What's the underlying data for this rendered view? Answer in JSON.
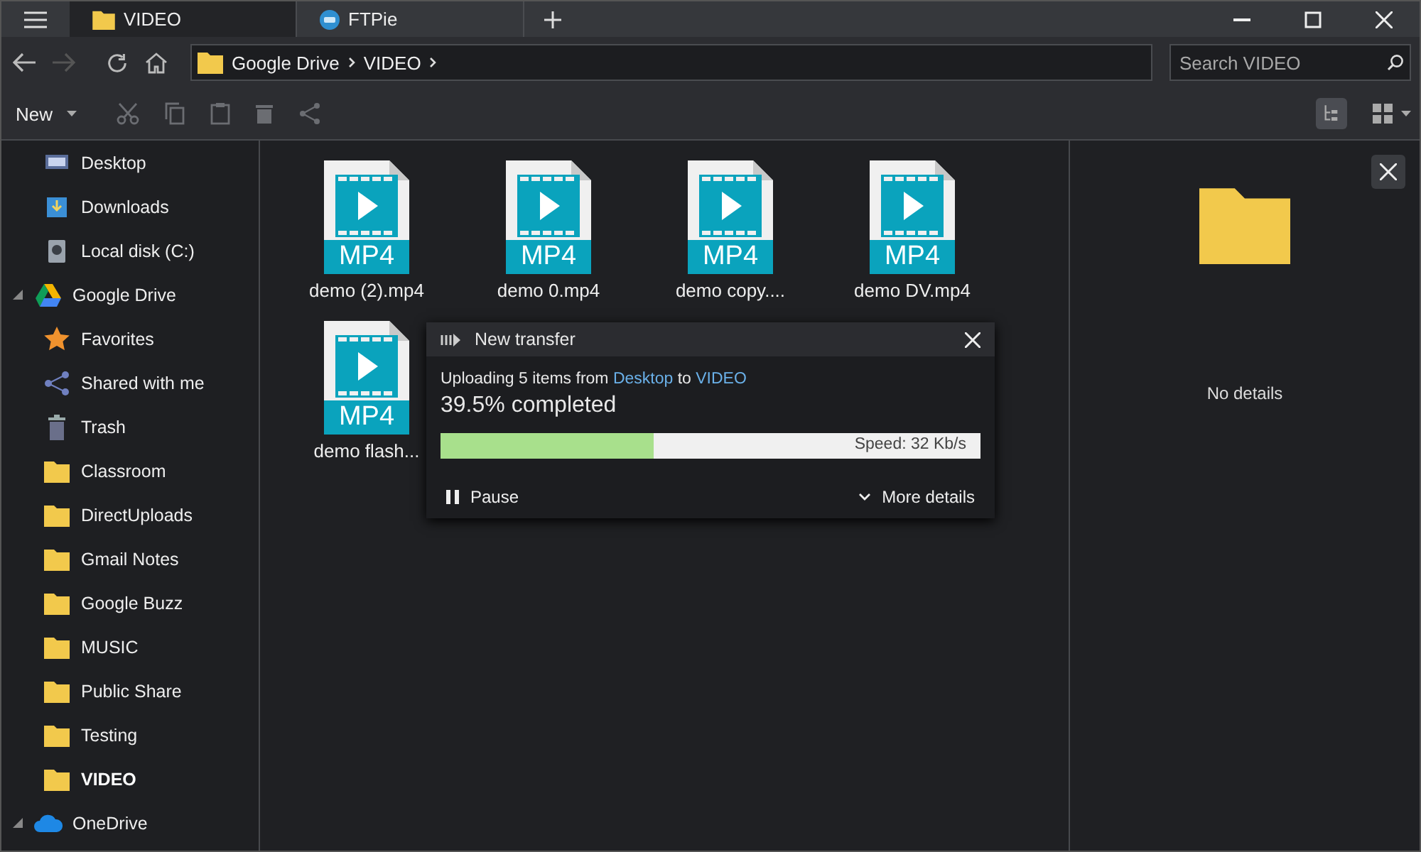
{
  "tabs": [
    {
      "label": "VIDEO",
      "kind": "folder",
      "selected": true
    },
    {
      "label": "FTPie",
      "kind": "app",
      "selected": false
    }
  ],
  "address": {
    "crumbs": [
      "Google Drive",
      "VIDEO"
    ]
  },
  "search": {
    "placeholder": "Search VIDEO"
  },
  "toolbar": {
    "new_label": "New"
  },
  "sidebar": {
    "items": [
      {
        "children": [
          {
            "label": "Desktop",
            "kind": "desktop",
            "selected": false
          },
          {
            "label": "Downloads",
            "kind": "download",
            "selected": false
          },
          {
            "label": "Local disk (C:)",
            "kind": "disk",
            "selected": false
          }
        ]
      },
      {
        "label": "Google Drive",
        "kind": "gdrive",
        "selected": false,
        "expanded": true,
        "children": [
          {
            "label": "Favorites",
            "kind": "star",
            "selected": false
          },
          {
            "label": "Shared with me",
            "kind": "share",
            "selected": false
          },
          {
            "label": "Trash",
            "kind": "trash",
            "selected": false
          },
          {
            "label": "Classroom",
            "kind": "folder",
            "selected": false
          },
          {
            "label": "DirectUploads",
            "kind": "folder",
            "selected": false
          },
          {
            "label": "Gmail Notes",
            "kind": "folder",
            "selected": false
          },
          {
            "label": "Google Buzz",
            "kind": "folder",
            "selected": false
          },
          {
            "label": "MUSIC",
            "kind": "folder",
            "selected": false
          },
          {
            "label": "Public Share",
            "kind": "folder",
            "selected": false
          },
          {
            "label": "Testing",
            "kind": "folder",
            "selected": false
          },
          {
            "label": "VIDEO",
            "kind": "folder",
            "selected": true
          }
        ]
      },
      {
        "label": "OneDrive",
        "kind": "cloud",
        "selected": false,
        "expanded": true
      }
    ]
  },
  "files": [
    {
      "badge": "MP4",
      "name": "demo (2).mp4"
    },
    {
      "badge": "MP4",
      "name": "demo 0.mp4"
    },
    {
      "badge": "MP4",
      "name": "demo copy...."
    },
    {
      "badge": "MP4",
      "name": "demo DV.mp4"
    },
    {
      "badge": "MP4",
      "name": "demo flash..."
    }
  ],
  "transfer": {
    "title": "New transfer",
    "message": [
      {
        "text": "Uploading 5 items from "
      },
      {
        "text": "Desktop",
        "kind": "link"
      },
      {
        "text": " to "
      },
      {
        "text": "VIDEO",
        "kind": "link"
      }
    ],
    "status": "39.5% completed",
    "level": 0.395,
    "speed": "Speed: 32 Kb/s",
    "pause_label": "Pause",
    "details_label": "More details"
  },
  "details": {
    "empty_text": "No details"
  }
}
